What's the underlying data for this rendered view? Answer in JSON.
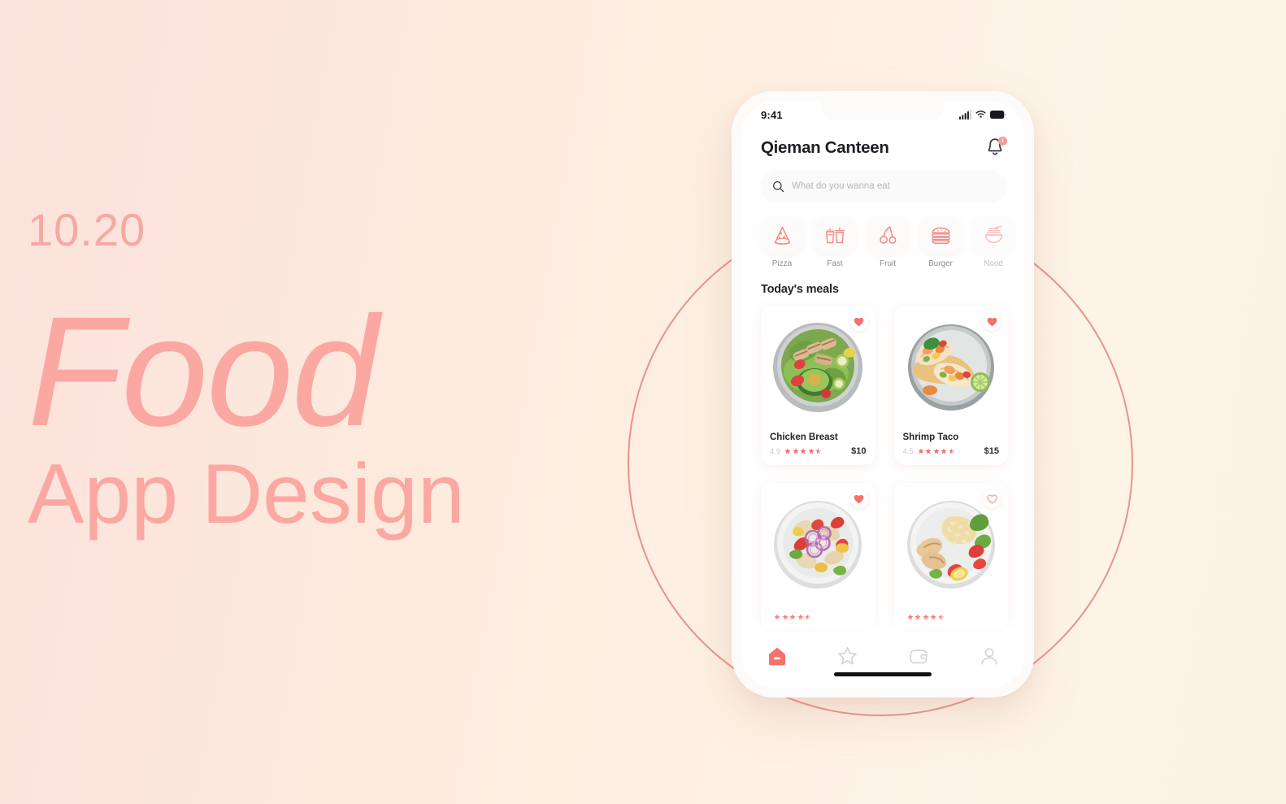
{
  "poster": {
    "date": "10.20",
    "headline": "Food",
    "subhead": "App Design",
    "accent_pink": "#fba8a2",
    "circle_color": "#e2827c",
    "bg_left": "#fbe2da",
    "bg_right": "#fdf3e4"
  },
  "phone": {
    "status_bar": {
      "time": "9:41",
      "icons": [
        "cellular-signal-icon",
        "wifi-icon",
        "battery-icon"
      ]
    },
    "home_indicator": true
  },
  "app": {
    "header": {
      "title": "Qieman Canteen",
      "notification_icon": "bell-icon",
      "notification_badge": "1"
    },
    "search": {
      "icon": "search-icon",
      "placeholder": "What do you wanna eat",
      "value": ""
    },
    "categories": [
      {
        "label": "Pizza",
        "icon": "pizza-icon",
        "faded": false
      },
      {
        "label": "Fast",
        "icon": "fastfood-icon",
        "faded": false
      },
      {
        "label": "Fruit",
        "icon": "cherry-icon",
        "faded": false
      },
      {
        "label": "Burger",
        "icon": "burger-icon",
        "faded": false
      },
      {
        "label": "Nood",
        "icon": "noodles-icon",
        "faded": true
      }
    ],
    "section": {
      "title": "Today's meals"
    },
    "meals": [
      {
        "name": "Chicken Breast",
        "rating": "4.9",
        "stars": 4.5,
        "price": "$10",
        "favorite": true,
        "photo": "grilled-chicken-avocado-salad-bowl"
      },
      {
        "name": "Shrimp Taco",
        "rating": "4.5",
        "stars": 4.5,
        "price": "$15",
        "favorite": true,
        "photo": "shrimp-tacos-with-lime-plate"
      },
      {
        "name": "",
        "rating": "",
        "stars": 4.5,
        "price": "",
        "favorite": true,
        "photo": "mixed-vegetable-chicken-salad-plate"
      },
      {
        "name": "",
        "rating": "",
        "stars": 4.5,
        "price": "",
        "favorite": false,
        "photo": "chicken-rice-salad-plate"
      }
    ],
    "bottom_nav": [
      {
        "icon": "home-icon",
        "active": true
      },
      {
        "icon": "star-icon",
        "active": false
      },
      {
        "icon": "wallet-icon",
        "active": false
      },
      {
        "icon": "profile-icon",
        "active": false
      }
    ]
  },
  "colors": {
    "accent_red": "#f2706a",
    "star_red": "#f4726c",
    "heart_red": "#f4726c",
    "nav_active": "#f4726c",
    "nav_inactive": "#d6d4d5",
    "text_dark": "#24262b",
    "text_muted": "#8f8d8e"
  }
}
